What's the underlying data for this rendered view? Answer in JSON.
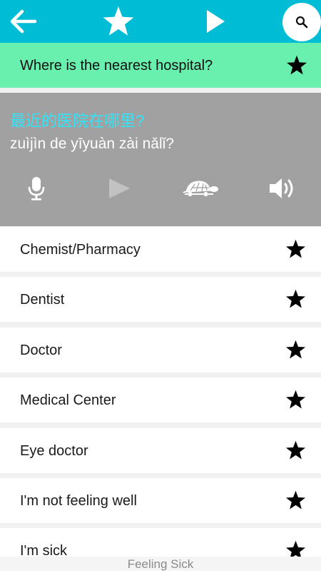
{
  "toolbar": {
    "back_icon": "arrow-left-icon",
    "favorite_icon": "star-icon",
    "play_icon": "play-icon",
    "search_icon": "search-icon",
    "color": "#00bcd4"
  },
  "selected_phrase": {
    "text": "Where is the nearest hospital?",
    "color": "#69f0ae"
  },
  "translation": {
    "chinese": "最近的医院在哪里?",
    "pinyin": "zuìjìn de yīyuàn zài nǎlǐ?",
    "controls": [
      "microphone-icon",
      "play-icon",
      "turtle-icon",
      "speaker-icon"
    ],
    "chinese_color": "#33e3f7"
  },
  "phrases": [
    {
      "label": "Chemist/Pharmacy"
    },
    {
      "label": "Dentist"
    },
    {
      "label": "Doctor"
    },
    {
      "label": "Medical Center"
    },
    {
      "label": "Eye doctor"
    },
    {
      "label": "I'm not feeling well"
    },
    {
      "label": "I'm sick"
    }
  ],
  "footer": {
    "category": "Feeling Sick"
  }
}
